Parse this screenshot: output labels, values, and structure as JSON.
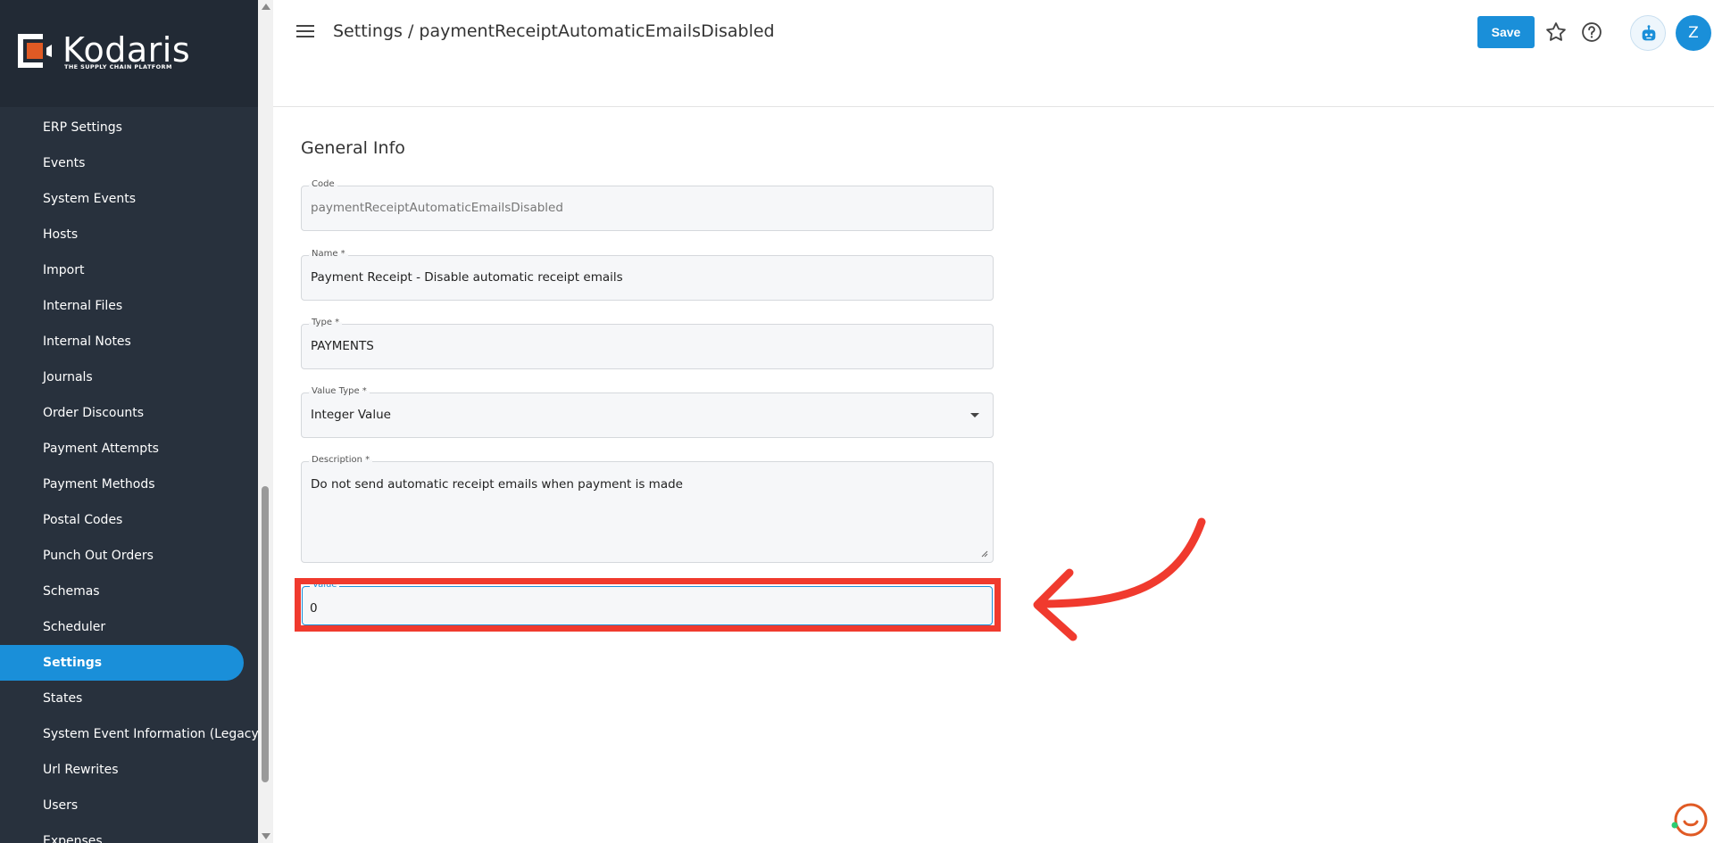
{
  "brand": {
    "name": "Kodaris",
    "tagline": "THE SUPPLY CHAIN PLATFORM",
    "accent": "#e05a24"
  },
  "sidebar": {
    "items": [
      {
        "label": "ERP Settings"
      },
      {
        "label": "Events"
      },
      {
        "label": "System Events"
      },
      {
        "label": "Hosts"
      },
      {
        "label": "Import"
      },
      {
        "label": "Internal Files"
      },
      {
        "label": "Internal Notes"
      },
      {
        "label": "Journals"
      },
      {
        "label": "Order Discounts"
      },
      {
        "label": "Payment Attempts"
      },
      {
        "label": "Payment Methods"
      },
      {
        "label": "Postal Codes"
      },
      {
        "label": "Punch Out Orders"
      },
      {
        "label": "Schemas"
      },
      {
        "label": "Scheduler"
      },
      {
        "label": "Settings",
        "active": true
      },
      {
        "label": "States"
      },
      {
        "label": "System Event Information (Legacy)"
      },
      {
        "label": "Url Rewrites"
      },
      {
        "label": "Users"
      },
      {
        "label": "Expenses"
      }
    ]
  },
  "header": {
    "title": "Settings / paymentReceiptAutomaticEmailsDisabled",
    "save_label": "Save",
    "avatar_initial": "Z",
    "icons": [
      "menu-icon",
      "star-icon",
      "help-icon",
      "robot-icon"
    ]
  },
  "form": {
    "section_title": "General Info",
    "code": {
      "label": "Code",
      "value": "paymentReceiptAutomaticEmailsDisabled"
    },
    "name": {
      "label": "Name *",
      "value": "Payment Receipt - Disable automatic receipt emails"
    },
    "type": {
      "label": "Type *",
      "value": "PAYMENTS"
    },
    "value_type": {
      "label": "Value Type *",
      "value": "Integer Value"
    },
    "description": {
      "label": "Description *",
      "value": "Do not send automatic receipt emails when payment is made"
    },
    "value": {
      "label": "Value",
      "value": "0"
    }
  },
  "colors": {
    "primary": "#1a8fd9",
    "sidebar_bg": "#28313d",
    "annotation_red": "#f03a2e"
  }
}
